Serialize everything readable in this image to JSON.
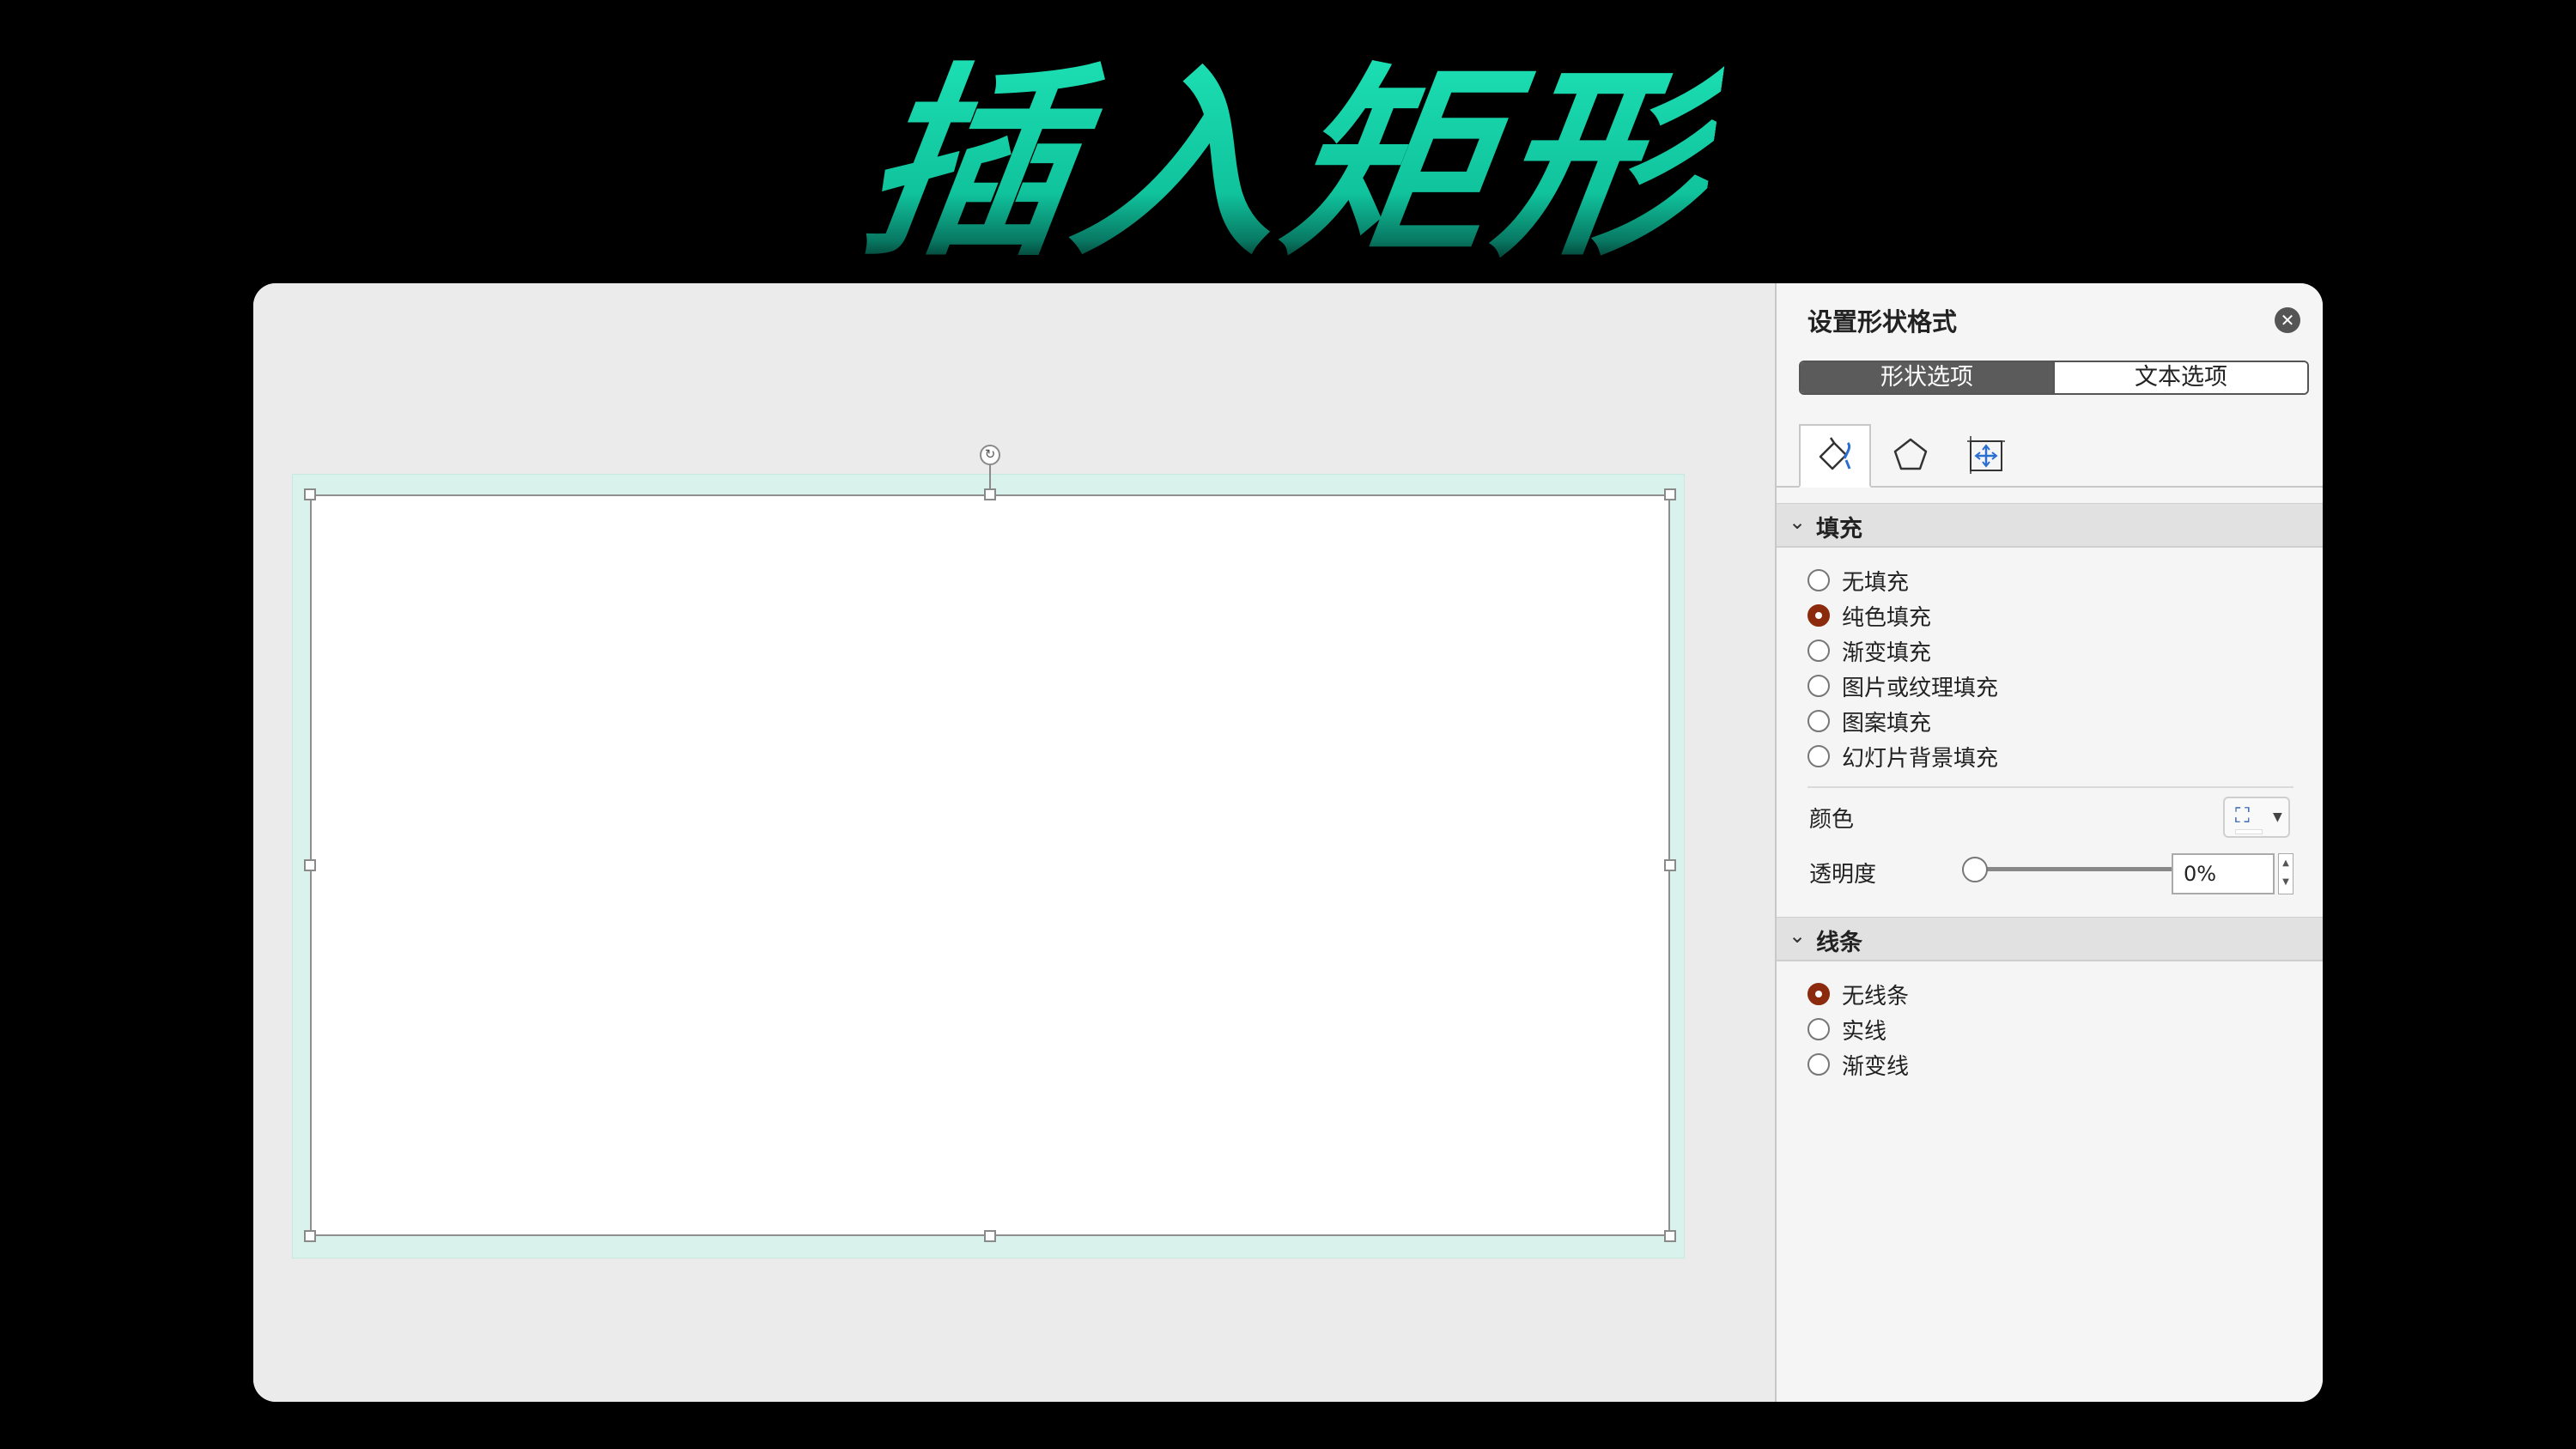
{
  "headline": "插入矩形",
  "panel": {
    "title": "设置形状格式",
    "tabs": [
      "形状选项",
      "文本选项"
    ],
    "icon_tabs": [
      "fill-line-icon",
      "effects-pentagon-icon",
      "size-properties-icon"
    ],
    "fill_section": {
      "label": "填充",
      "options": [
        "无填充",
        "纯色填充",
        "渐变填充",
        "图片或纹理填充",
        "图案填充",
        "幻灯片背景填充"
      ],
      "selected": "纯色填充",
      "color_label": "颜色",
      "transparency_label": "透明度",
      "transparency_value": "0%",
      "transparency_fraction": 0
    },
    "line_section": {
      "label": "线条",
      "options": [
        "无线条",
        "实线",
        "渐变线"
      ],
      "selected": "无线条"
    }
  },
  "colors": {
    "headline": "#12c9a2",
    "selected_radio": "#8b2a0c",
    "selection_halo": "#d9f2ec"
  }
}
